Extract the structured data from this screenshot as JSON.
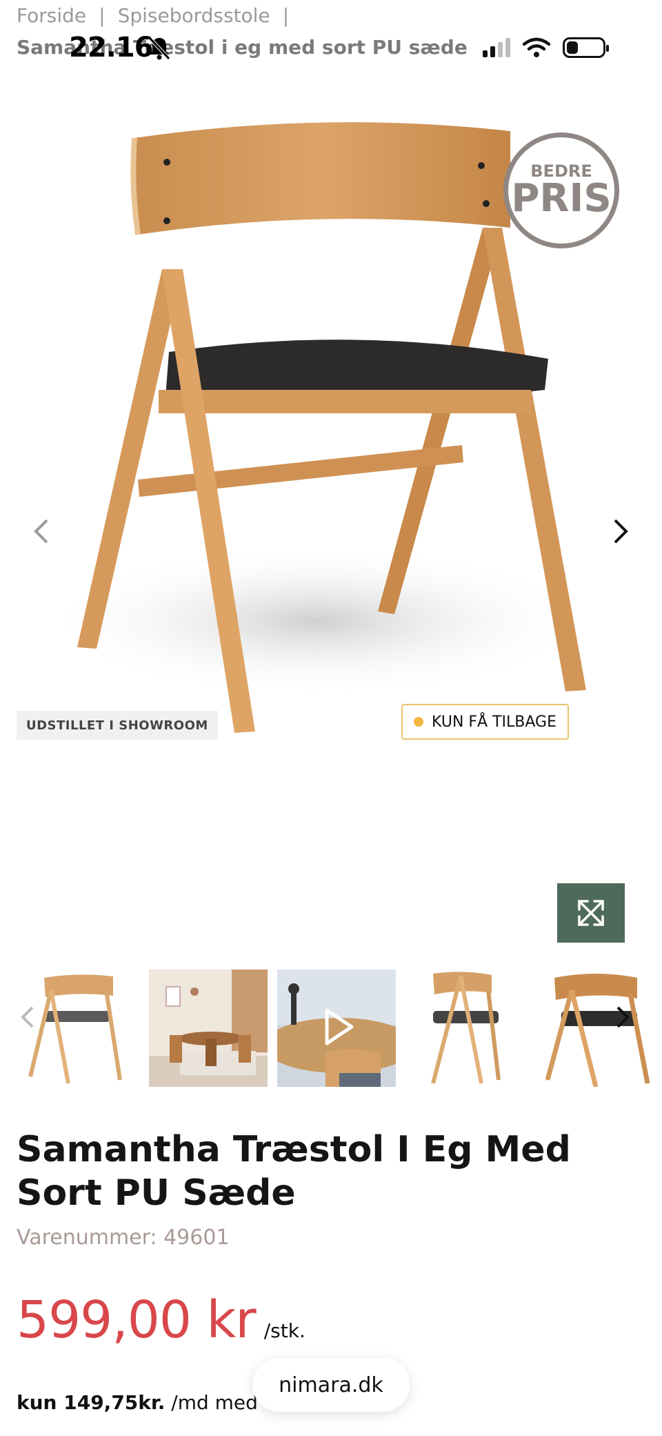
{
  "breadcrumb": {
    "items": [
      "Forside",
      "Spisebordsstole"
    ],
    "separator": "|",
    "current": "Samantha Træstol i eg med sort PU sæde"
  },
  "status_bar": {
    "time": "22.16",
    "icons": [
      "bell-slash-icon",
      "signal-icon",
      "wifi-icon",
      "battery-icon"
    ]
  },
  "hero": {
    "badge_top": "BEDRE",
    "badge_main": "PRIS",
    "showroom_tag": "UDSTILLET I SHOWROOM",
    "stock_tag": "KUN FÅ TILBAGE",
    "prev_icon": "chevron-left-icon",
    "next_icon": "chevron-right-icon"
  },
  "zoom": {
    "icon": "expand-icon"
  },
  "thumbnails": {
    "count": 5
  },
  "product": {
    "title": "Samantha Træstol I Eg Med Sort PU Sæde",
    "sku": "Varenummer: 49601",
    "price": "599,00 kr",
    "unit": "/stk.",
    "finance_bold": "kun 149,75kr.",
    "finance_rest": "/md med"
  },
  "browser": {
    "url": "nimara.dk"
  },
  "colors": {
    "price": "#d8474a",
    "zoom_button": "#4e6a5b",
    "badge": "#8e8784",
    "stock_border": "#e8c36a"
  }
}
